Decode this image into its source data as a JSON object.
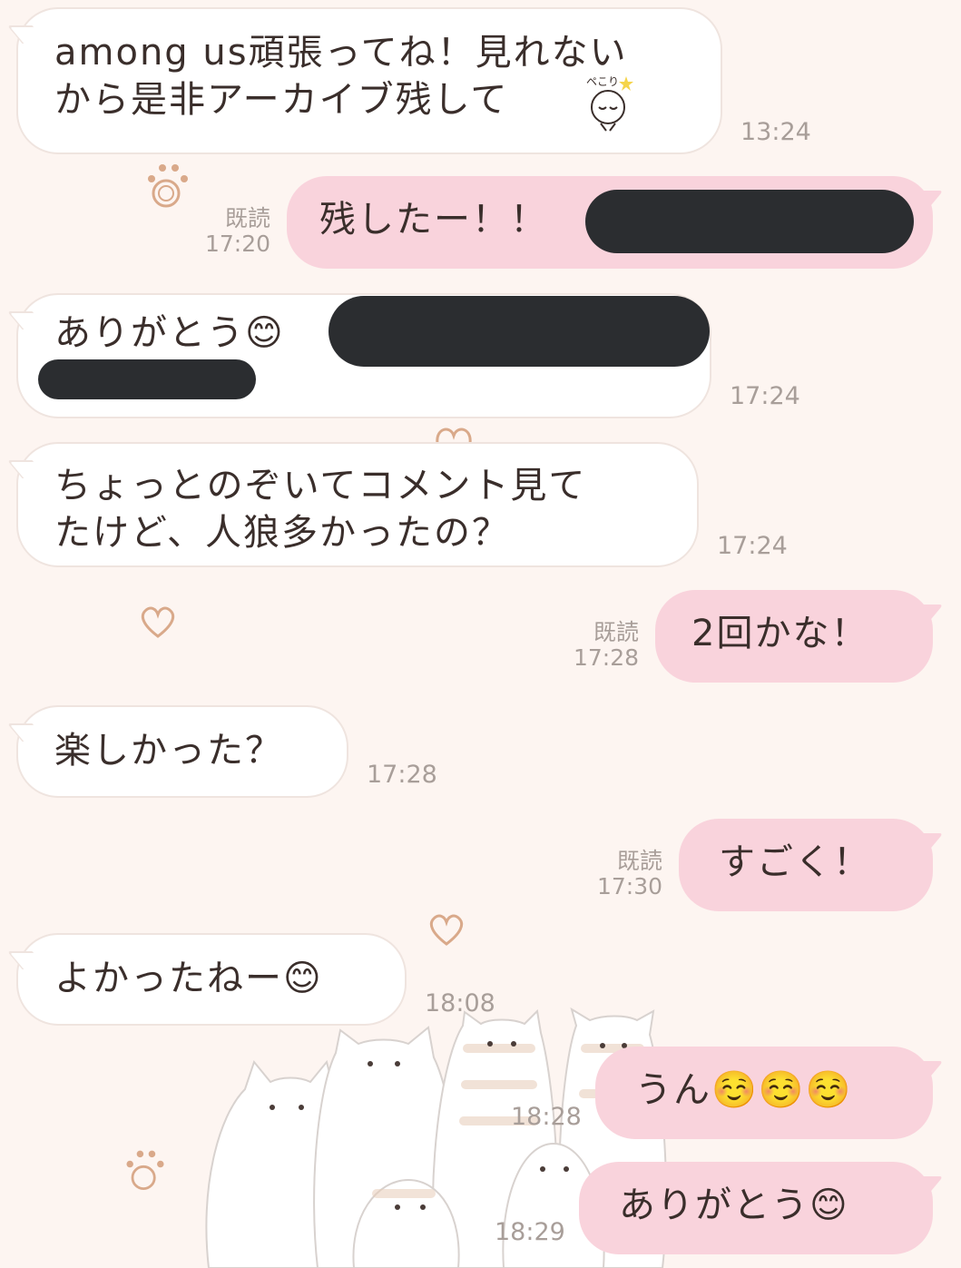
{
  "messages": [
    {
      "side": "in",
      "lines": [
        "among us頑張ってね！見れない",
        "から是非アーカイブ残して"
      ],
      "time": "13:24"
    },
    {
      "side": "out",
      "text": "残したー！！",
      "read": "既読",
      "time": "17:20"
    },
    {
      "side": "in",
      "text": "ありがとう",
      "emoji": "😊",
      "time": "17:24"
    },
    {
      "side": "in",
      "lines": [
        "ちょっとのぞいてコメント見て",
        "たけど、人狼多かったの？"
      ],
      "time": "17:24"
    },
    {
      "side": "out",
      "text": "2回かな！",
      "read": "既読",
      "time": "17:28"
    },
    {
      "side": "in",
      "text": "楽しかった？",
      "time": "17:28"
    },
    {
      "side": "out",
      "text": "すごく！",
      "read": "既読",
      "time": "17:30"
    },
    {
      "side": "in",
      "text": "よかったねー",
      "emoji": "😊",
      "time": "18:08"
    },
    {
      "side": "out",
      "text": "うん",
      "emoji": "☺️☺️☺️",
      "time": "18:28"
    },
    {
      "side": "out",
      "text": "ありがとう",
      "emoji": "😊",
      "time": "18:29"
    }
  ],
  "stamp": {
    "text": "ペこり"
  },
  "colors": {
    "background": "#fdf5f1",
    "incoming_bubble": "#ffffff",
    "outgoing_bubble": "#f9d3dc",
    "redaction": "#2b2d30",
    "text": "#3a2e2b",
    "meta": "#a89e99"
  }
}
